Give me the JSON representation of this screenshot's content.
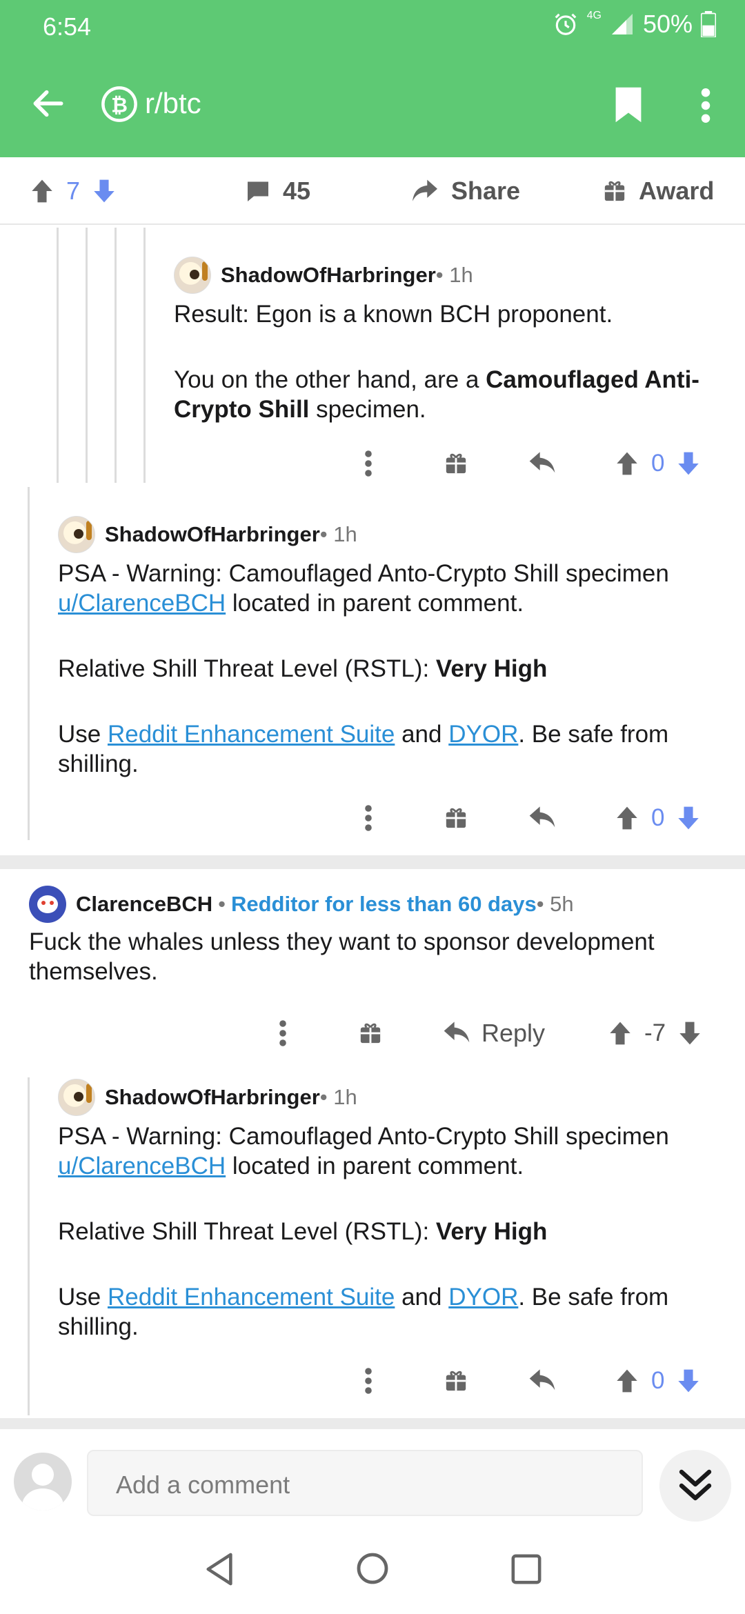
{
  "status": {
    "time": "6:54",
    "network": "4G",
    "battery": "50%"
  },
  "header": {
    "subreddit": "r/btc"
  },
  "postbar": {
    "score": "7",
    "comments": "45",
    "share_label": "Share",
    "award_label": "Award"
  },
  "comments": [
    {
      "author": "ShadowOfHarbringer",
      "meta": " • 1h",
      "body": {
        "p1": "Result: Egon is a known BCH proponent.",
        "p2_a": "You on the other hand, are a ",
        "p2_b": "Camouflaged Anti-Crypto Shill",
        "p2_c": " specimen."
      },
      "score": "0"
    },
    {
      "author": "ShadowOfHarbringer",
      "meta": " • 1h",
      "body": {
        "p1_a": "PSA - Warning: Camouflaged Anto-Crypto Shill specimen ",
        "p1_link": "u/ClarenceBCH",
        "p1_c": " located in parent comment.",
        "p2_a": "Relative Shill Threat Level (RSTL): ",
        "p2_b": "Very High",
        "p3_a": "Use ",
        "p3_link1": "Reddit Enhancement Suite",
        "p3_b": " and ",
        "p3_link2": "DYOR",
        "p3_c": ". Be safe from shilling."
      },
      "score": "0"
    },
    {
      "author": "ClarenceBCH",
      "flair": "Redditor for less than 60 days",
      "meta": " • 5h",
      "body": {
        "p1": "Fuck the whales unless they want to sponsor development themselves."
      },
      "reply_label": "Reply",
      "score": "-7"
    },
    {
      "author": "ShadowOfHarbringer",
      "meta": " • 1h",
      "body": {
        "p1_a": "PSA - Warning: Camouflaged Anto-Crypto Shill specimen ",
        "p1_link": "u/ClarenceBCH",
        "p1_c": " located in parent comment.",
        "p2_a": "Relative Shill Threat Level (RSTL): ",
        "p2_b": "Very High",
        "p3_a": "Use ",
        "p3_link1": "Reddit Enhancement Suite",
        "p3_b": " and ",
        "p3_link2": "DYOR",
        "p3_c": ". Be safe from shilling."
      },
      "score": "0"
    }
  ],
  "composer": {
    "placeholder": "Add a comment"
  },
  "colors": {
    "brand": "#5ec974",
    "upvote_blue": "#6a8cf0",
    "link": "#2a8fd6"
  },
  "icons": [
    "back-arrow-icon",
    "bitcoin-icon",
    "bookmark-icon",
    "more-vert-icon",
    "upvote-icon",
    "downvote-icon",
    "comment-icon",
    "share-icon",
    "gift-icon",
    "reply-icon",
    "double-chevron-down-icon"
  ]
}
